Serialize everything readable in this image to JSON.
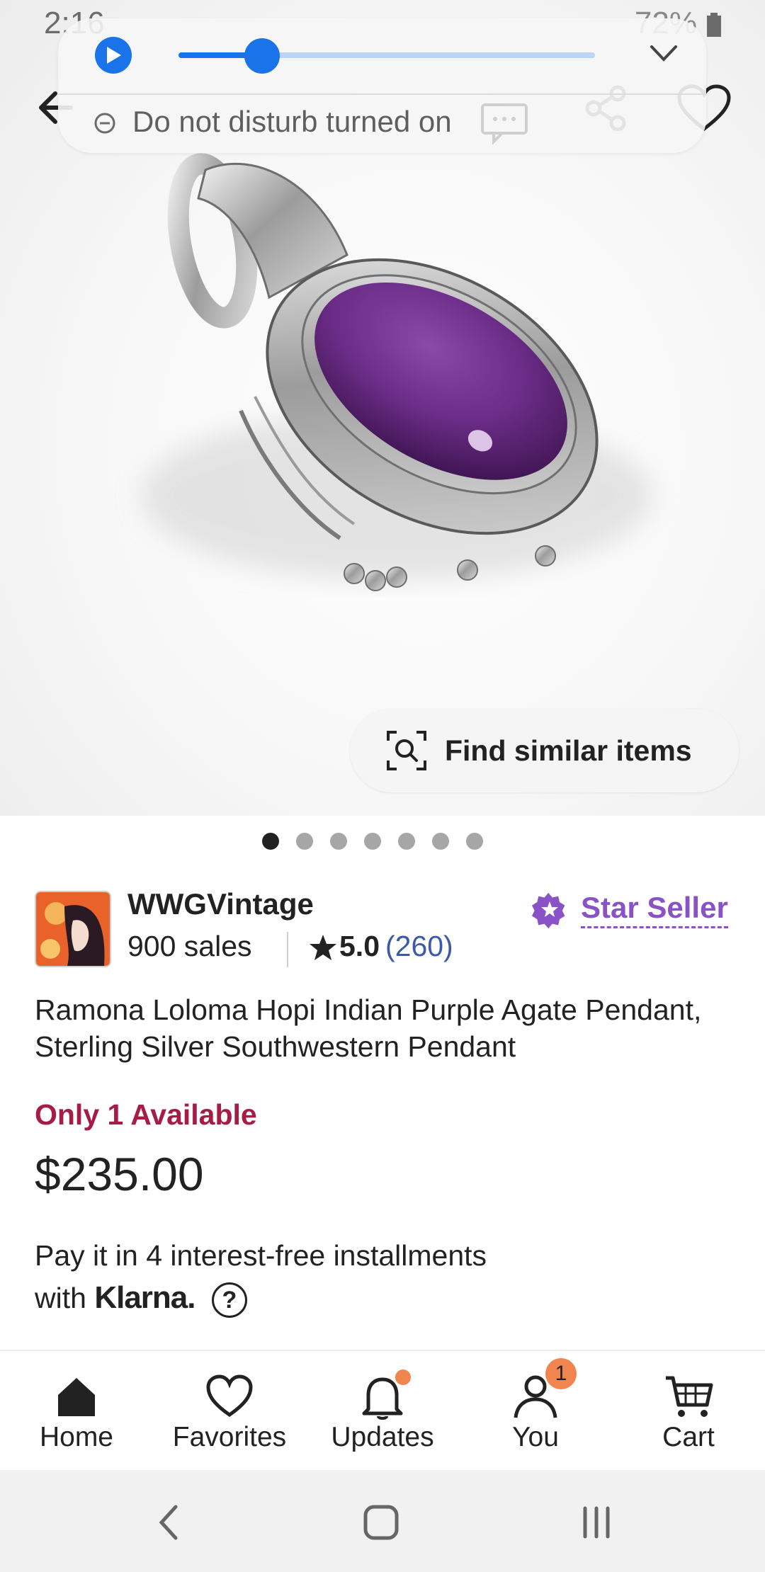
{
  "status_bar": {
    "time": "2:16",
    "battery": "72%"
  },
  "media_panel": {
    "progress_fraction": 0.2,
    "dnd_text": "Do not disturb turned on"
  },
  "gallery": {
    "find_similar_label": "Find similar items",
    "total_images": 7,
    "active_index": 0
  },
  "shop": {
    "name": "WWGVintage",
    "sales": "900 sales",
    "rating": "5.0",
    "review_count": "(260)",
    "star_seller_label": "Star Seller"
  },
  "product": {
    "title": "Ramona Loloma Hopi Indian Purple Agate Pendant, Sterling Silver Southwestern Pendant",
    "availability": "Only 1 Available",
    "price": "$235.00",
    "installments_text": "Pay it in 4 interest-free installments",
    "installments_with": "with",
    "klarna": "Klarna."
  },
  "bottom_nav": {
    "items": [
      {
        "label": "Home",
        "icon": "home-icon"
      },
      {
        "label": "Favorites",
        "icon": "heart-icon"
      },
      {
        "label": "Updates",
        "icon": "bell-icon"
      },
      {
        "label": "You",
        "icon": "person-icon"
      },
      {
        "label": "Cart",
        "icon": "cart-icon"
      }
    ],
    "you_badge": "1"
  },
  "colors": {
    "accent_blue": "#1a73e8",
    "availability_red": "#a51d45",
    "star_seller_purple": "#8a52c7",
    "review_link_blue": "#3c5aa6",
    "notification_orange": "#f0854f"
  }
}
